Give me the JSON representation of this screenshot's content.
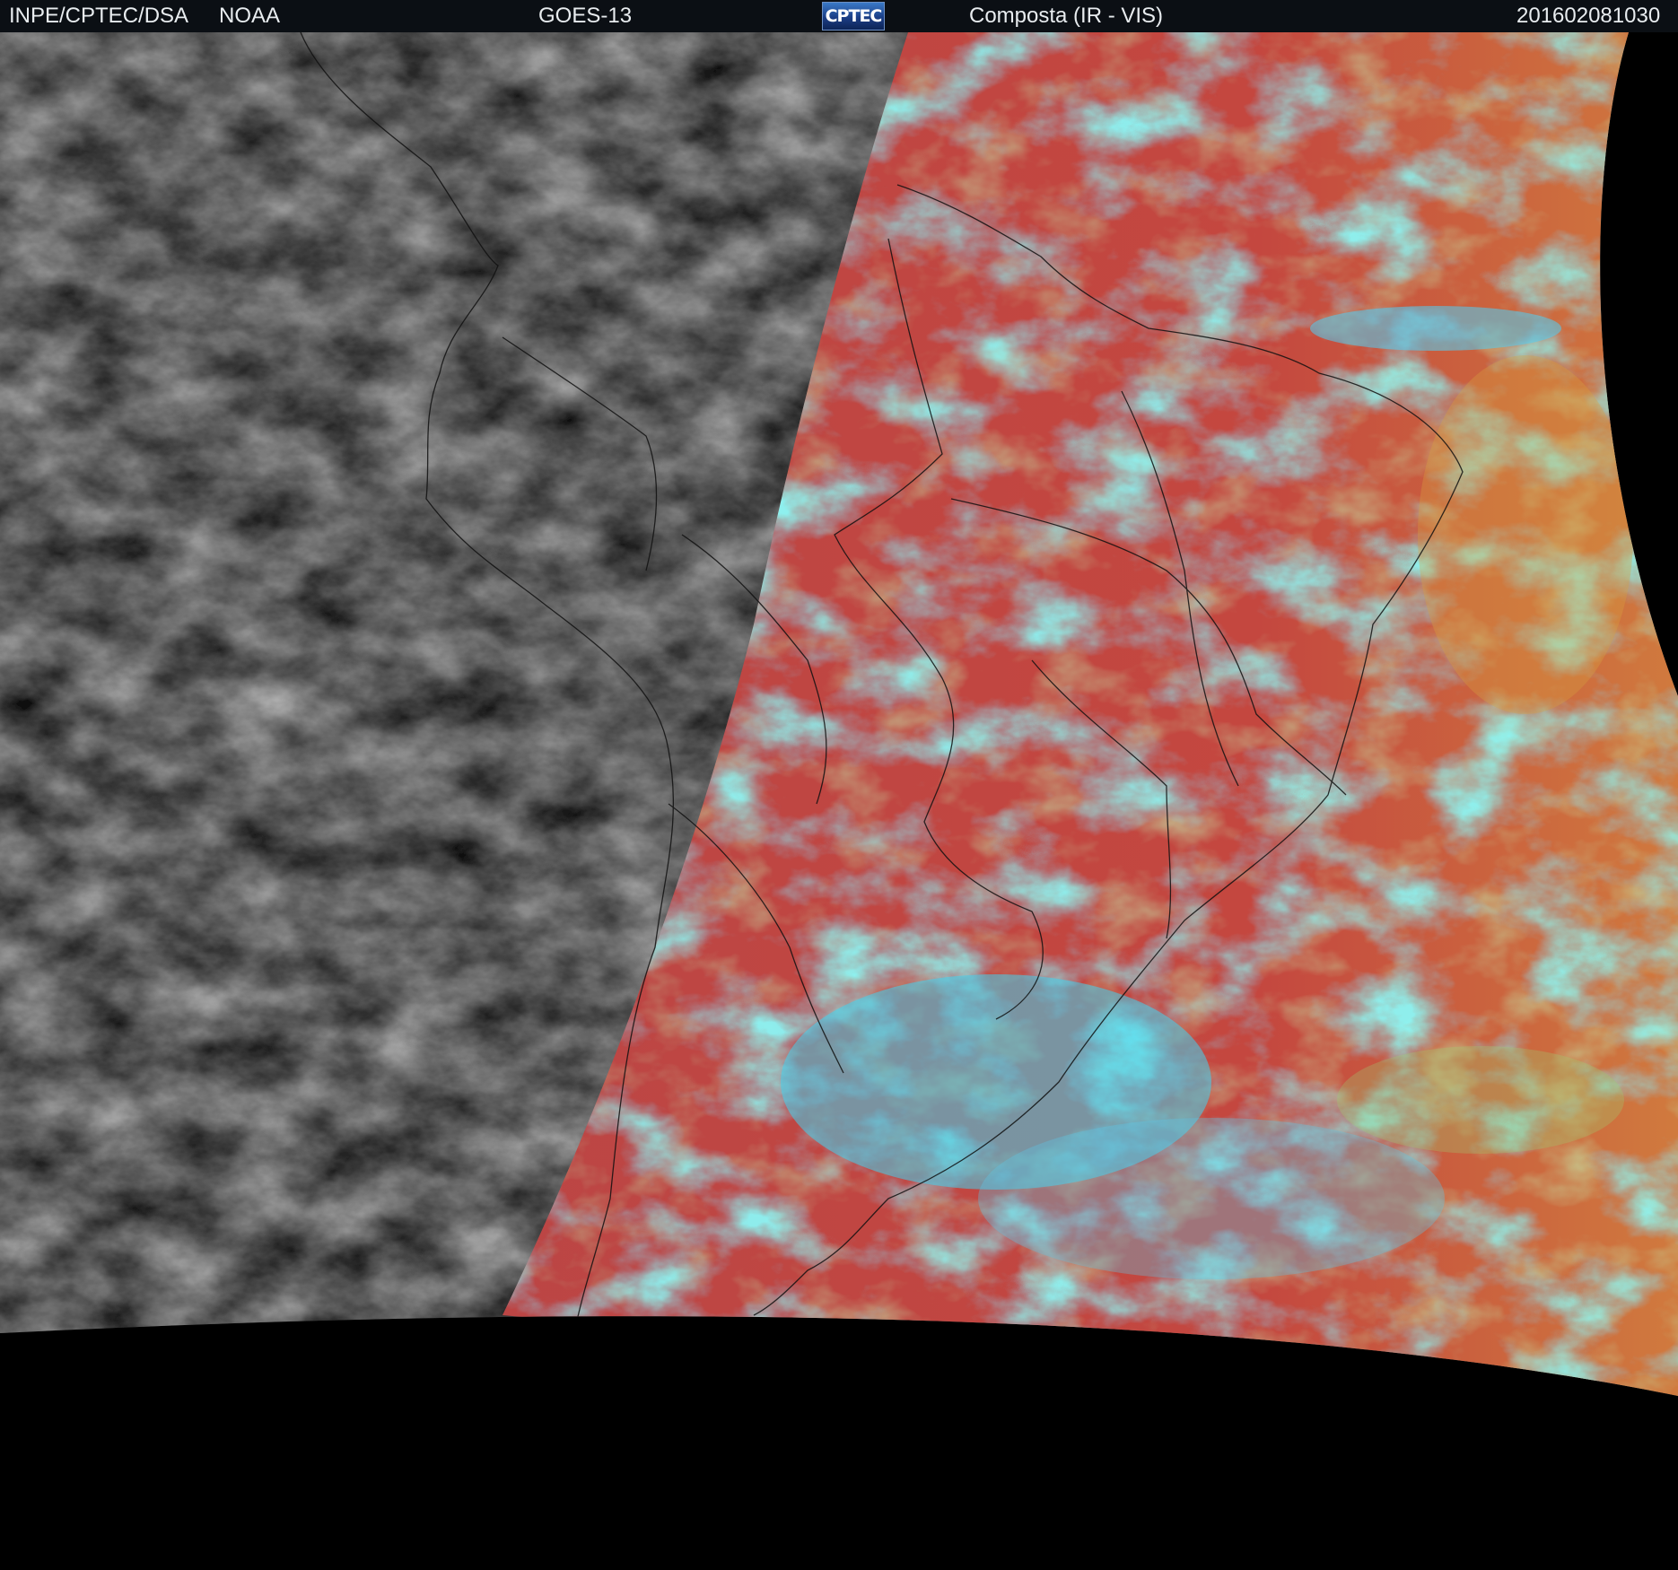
{
  "header": {
    "institution": "INPE/CPTEC/DSA",
    "agency": "NOAA",
    "satellite": "GOES-13",
    "logo_text": "CPTEC",
    "product": "Composta (IR - VIS)",
    "timestamp": "201602081030"
  },
  "colors": {
    "header_bg": "#0b0f14",
    "header_text": "#e8ecef",
    "ir_gray": "#3a3a3a",
    "composite_red": "#c0443e",
    "composite_cyan": "#3fd3f0",
    "composite_green": "#8ee07a",
    "composite_orange": "#d2813e",
    "space_black": "#000000"
  },
  "map": {
    "region": "South America",
    "left_panel": "IR grayscale",
    "right_panel": "IR - VIS color composite"
  }
}
